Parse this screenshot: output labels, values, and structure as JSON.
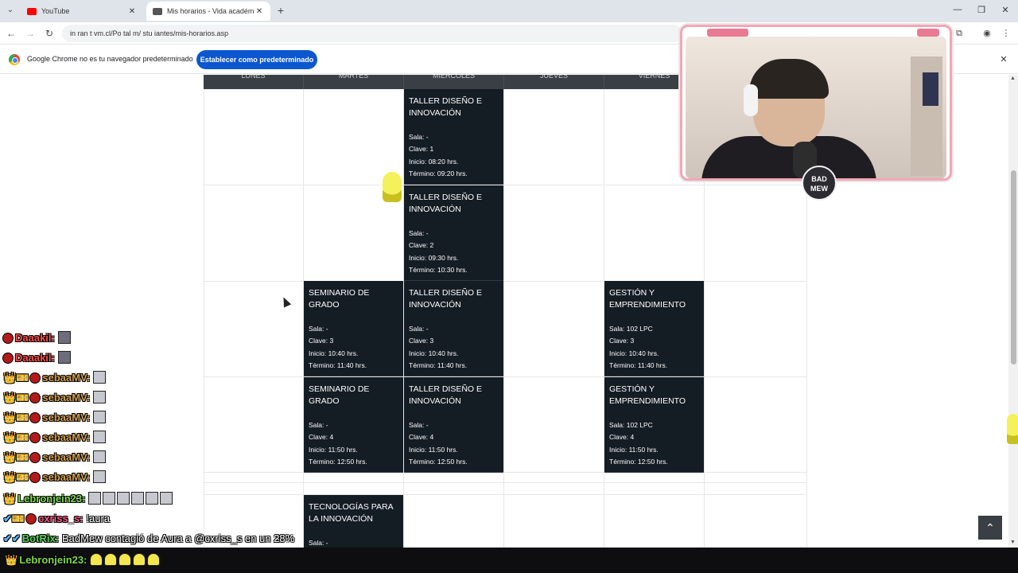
{
  "browser": {
    "tabs": [
      {
        "title": "YouTube",
        "favicon_color": "#ff0000",
        "active": false
      },
      {
        "title": "Mis horarios - Vida académica",
        "favicon_color": "#555555",
        "active": true
      }
    ],
    "url": "in ran  t vm.cl/Po  tal   m/  stu  iantes/mis-horarios.asp",
    "infobar": {
      "message": "Google Chrome no es tu navegador predeterminado",
      "button": "Establecer como predeterminado"
    }
  },
  "schedule": {
    "days": [
      "LUNES",
      "MARTES",
      "MIÉRCOLES",
      "JUEVES",
      "VIERNES",
      ""
    ],
    "labels": {
      "sala": "Sala:",
      "clave": "Clave:",
      "inicio": "Inicio:",
      "termino": "Término:"
    },
    "blocks": [
      {
        "day": "MIÉRCOLES",
        "title": "TALLER DISEÑO E INNOVACIÓN",
        "sala": "Sala: -",
        "clave": "Clave: 1",
        "inicio": "Inicio: 08:20 hrs.",
        "termino": "Término: 09:20 hrs."
      },
      {
        "day": "MIÉRCOLES",
        "title": "TALLER DISEÑO E INNOVACIÓN",
        "sala": "Sala: -",
        "clave": "Clave: 2",
        "inicio": "Inicio: 09:30 hrs.",
        "termino": "Término: 10:30 hrs."
      },
      {
        "day": "MARTES",
        "title": "SEMINARIO DE GRADO",
        "sala": "Sala: -",
        "clave": "Clave: 3",
        "inicio": "Inicio: 10:40 hrs.",
        "termino": "Término: 11:40 hrs."
      },
      {
        "day": "MIÉRCOLES",
        "title": "TALLER DISEÑO E INNOVACIÓN",
        "sala": "Sala: -",
        "clave": "Clave: 3",
        "inicio": "Inicio: 10:40 hrs.",
        "termino": "Término: 11:40 hrs."
      },
      {
        "day": "VIERNES",
        "title": "GESTIÓN Y EMPRENDIMIENTO",
        "sala": "Sala: 102 LPC",
        "clave": "Clave: 3",
        "inicio": "Inicio: 10:40 hrs.",
        "termino": "Término: 11:40 hrs."
      },
      {
        "day": "MARTES",
        "title": "SEMINARIO DE GRADO",
        "sala": "Sala: -",
        "clave": "Clave: 4",
        "inicio": "Inicio: 11:50 hrs.",
        "termino": "Término: 12:50 hrs."
      },
      {
        "day": "MIÉRCOLES",
        "title": "TALLER DISEÑO E INNOVACIÓN",
        "sala": "Sala: -",
        "clave": "Clave: 4",
        "inicio": "Inicio: 11:50 hrs.",
        "termino": "Término: 12:50 hrs."
      },
      {
        "day": "VIERNES",
        "title": "GESTIÓN Y EMPRENDIMIENTO",
        "sala": "Sala: 102 LPC",
        "clave": "Clave: 4",
        "inicio": "Inicio: 11:50 hrs.",
        "termino": "Término: 12:50 hrs."
      },
      {
        "day": "MARTES",
        "title": "TECNOLOGÍAS PARA LA INNOVACIÓN",
        "sala": "Sala: -",
        "clave": "",
        "inicio": "",
        "termino": ""
      }
    ]
  },
  "stream": {
    "webcam_badge": "BAD MEW",
    "chat": [
      {
        "user": "Daaakil:",
        "color": "#ff4d4d",
        "badges": "",
        "msg": ""
      },
      {
        "user": "Daaakil:",
        "color": "#ff4d4d",
        "badges": "",
        "msg": ""
      },
      {
        "user": "sebaaMV:",
        "color": "#d4a04a",
        "badges": "👑🎫",
        "msg": ""
      },
      {
        "user": "sebaaMV:",
        "color": "#d4a04a",
        "badges": "👑🎫",
        "msg": ""
      },
      {
        "user": "sebaaMV:",
        "color": "#d4a04a",
        "badges": "👑🎫",
        "msg": ""
      },
      {
        "user": "sebaaMV:",
        "color": "#d4a04a",
        "badges": "👑🎫",
        "msg": ""
      },
      {
        "user": "sebaaMV:",
        "color": "#d4a04a",
        "badges": "👑🎫",
        "msg": ""
      },
      {
        "user": "sebaaMV:",
        "color": "#d4a04a",
        "badges": "👑🎫",
        "msg": ""
      },
      {
        "user": "Lebronjein23:",
        "color": "#7cd94a",
        "badges": "👑",
        "msg": ""
      },
      {
        "user": "cxriss_s:",
        "color": "#ff5a8a",
        "badges": "✔🎫",
        "msg": "!aura"
      },
      {
        "user": "BotRix:",
        "color": "#5ad35a",
        "badges": "✔✔",
        "msg": "BadMew contagió de Aura a @cxriss_s en un 28%"
      }
    ],
    "footer": {
      "user": "Lebronjein23:",
      "color": "#7cd94a",
      "badges": "👑",
      "msg": ""
    }
  }
}
